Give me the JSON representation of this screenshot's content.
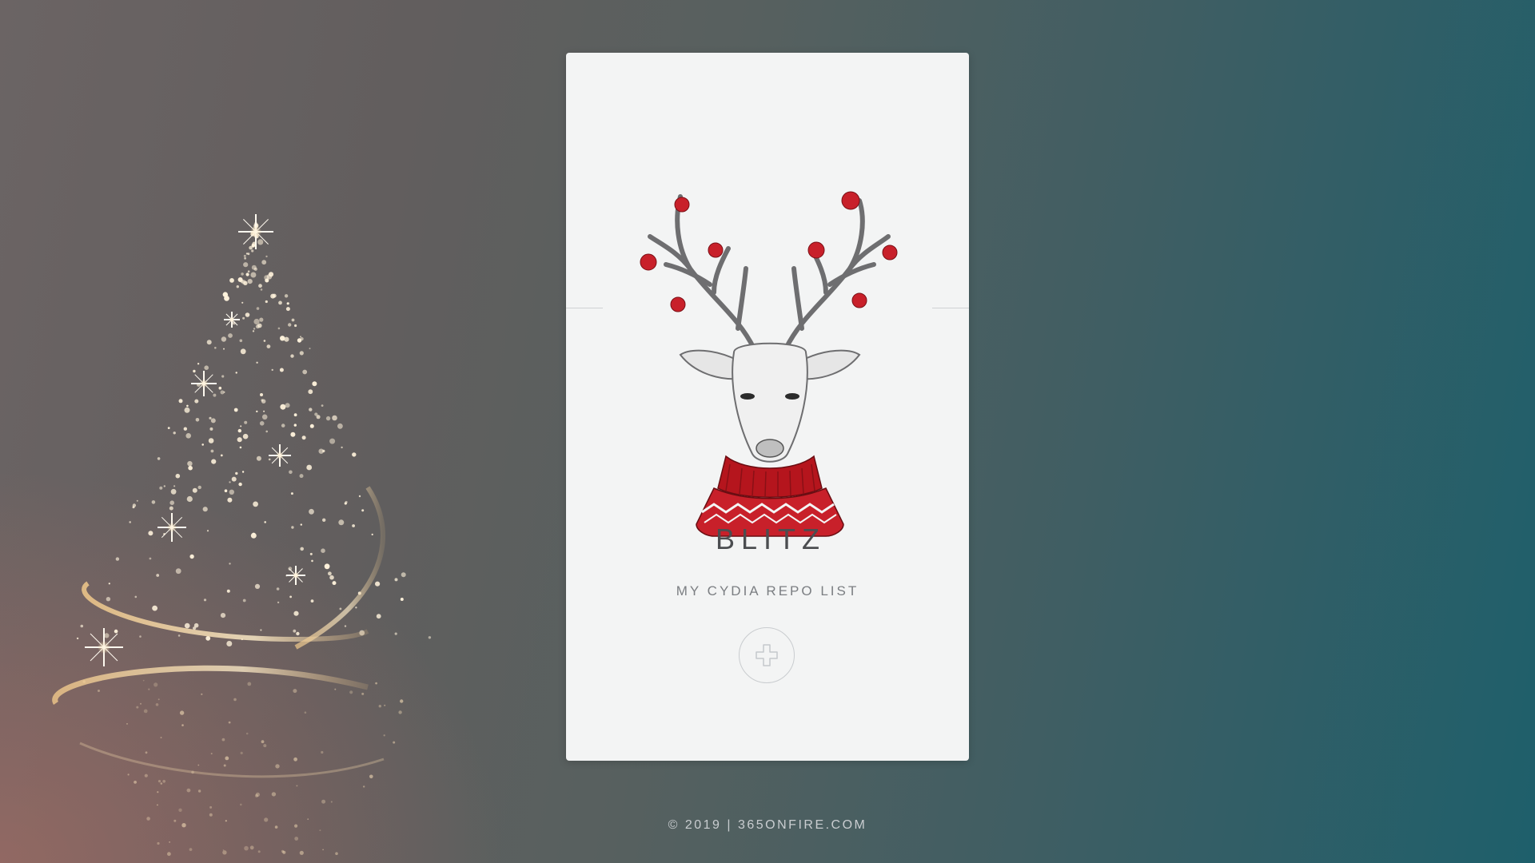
{
  "card": {
    "title": "BLITZ",
    "subtitle": "MY CYDIA REPO LIST",
    "add_button_icon": "plus-icon",
    "illustration": "reindeer-in-sweater"
  },
  "background": {
    "decoration": "sparkle-christmas-tree",
    "colors": {
      "left": "#6b6464",
      "right": "#1e5f6b",
      "warm_glow": "#b46e64"
    }
  },
  "footer": {
    "copyright": "© 2019 | ",
    "link": "365ONFIRE.COM"
  },
  "colors": {
    "card_bg": "#f3f4f4",
    "title": "#4b4d50",
    "ornament_red": "#c8202a"
  }
}
